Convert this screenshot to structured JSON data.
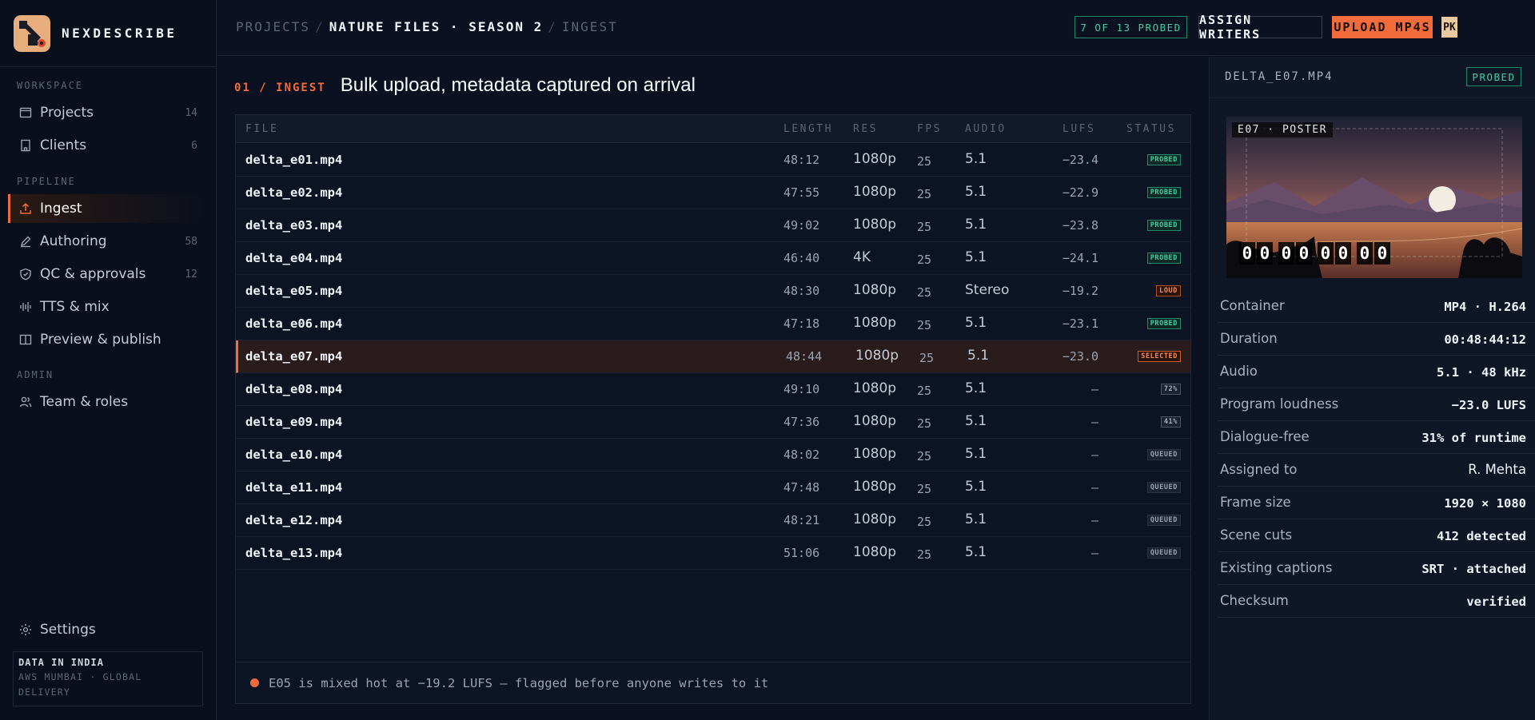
{
  "brand": {
    "name": "NEXDESCRIBE"
  },
  "sidebar": {
    "sections": {
      "workspace": "WORKSPACE",
      "pipeline": "PIPELINE",
      "admin": "ADMIN"
    },
    "items": [
      {
        "label": "Projects",
        "count": "14",
        "icon": "folder-icon"
      },
      {
        "label": "Clients",
        "count": "6",
        "icon": "building-icon"
      },
      {
        "label": "Ingest",
        "count": "",
        "icon": "upload-icon",
        "active": true
      },
      {
        "label": "Authoring",
        "count": "58",
        "icon": "pen-icon"
      },
      {
        "label": "QC & approvals",
        "count": "12",
        "icon": "shield-check-icon"
      },
      {
        "label": "TTS & mix",
        "count": "",
        "icon": "waveform-icon"
      },
      {
        "label": "Preview & publish",
        "count": "",
        "icon": "book-open-icon"
      },
      {
        "label": "Team & roles",
        "count": "",
        "icon": "users-icon"
      }
    ],
    "settings": "Settings",
    "region": {
      "title": "DATA IN INDIA",
      "subtitle": "AWS MUMBAI · GLOBAL DELIVERY"
    }
  },
  "header": {
    "breadcrumb": [
      "PROJECTS",
      "NATURE FILES · SEASON 2",
      "INGEST"
    ],
    "probed_status": "7 OF 13 PROBED",
    "assign_label": "ASSIGN WRITERS",
    "upload_label": "UPLOAD MP4S",
    "avatar_initials": "PK"
  },
  "main": {
    "step": "01 / INGEST",
    "title": "Bulk upload, metadata captured on arrival",
    "columns": [
      "FILE",
      "LENGTH",
      "RES",
      "FPS",
      "AUDIO",
      "LUFS",
      "STATUS"
    ],
    "rows": [
      {
        "file": "delta_e01.mp4",
        "length": "48:12",
        "res": "1080p",
        "fps": "25",
        "audio": "5.1",
        "lufs": "−23.4",
        "status": "PROBED",
        "kind": "probed"
      },
      {
        "file": "delta_e02.mp4",
        "length": "47:55",
        "res": "1080p",
        "fps": "25",
        "audio": "5.1",
        "lufs": "−22.9",
        "status": "PROBED",
        "kind": "probed"
      },
      {
        "file": "delta_e03.mp4",
        "length": "49:02",
        "res": "1080p",
        "fps": "25",
        "audio": "5.1",
        "lufs": "−23.8",
        "status": "PROBED",
        "kind": "probed"
      },
      {
        "file": "delta_e04.mp4",
        "length": "46:40",
        "res": "4K",
        "fps": "25",
        "audio": "5.1",
        "lufs": "−24.1",
        "status": "PROBED",
        "kind": "probed"
      },
      {
        "file": "delta_e05.mp4",
        "length": "48:30",
        "res": "1080p",
        "fps": "25",
        "audio": "Stereo",
        "lufs": "−19.2",
        "status": "LOUD",
        "kind": "loud"
      },
      {
        "file": "delta_e06.mp4",
        "length": "47:18",
        "res": "1080p",
        "fps": "25",
        "audio": "5.1",
        "lufs": "−23.1",
        "status": "PROBED",
        "kind": "probed"
      },
      {
        "file": "delta_e07.mp4",
        "length": "48:44",
        "res": "1080p",
        "fps": "25",
        "audio": "5.1",
        "lufs": "−23.0",
        "status": "SELECTED",
        "kind": "selected"
      },
      {
        "file": "delta_e08.mp4",
        "length": "49:10",
        "res": "1080p",
        "fps": "25",
        "audio": "5.1",
        "lufs": "—",
        "status": "72%",
        "kind": "pct"
      },
      {
        "file": "delta_e09.mp4",
        "length": "47:36",
        "res": "1080p",
        "fps": "25",
        "audio": "5.1",
        "lufs": "—",
        "status": "41%",
        "kind": "pct"
      },
      {
        "file": "delta_e10.mp4",
        "length": "48:02",
        "res": "1080p",
        "fps": "25",
        "audio": "5.1",
        "lufs": "—",
        "status": "QUEUED",
        "kind": "queued"
      },
      {
        "file": "delta_e11.mp4",
        "length": "47:48",
        "res": "1080p",
        "fps": "25",
        "audio": "5.1",
        "lufs": "—",
        "status": "QUEUED",
        "kind": "queued"
      },
      {
        "file": "delta_e12.mp4",
        "length": "48:21",
        "res": "1080p",
        "fps": "25",
        "audio": "5.1",
        "lufs": "—",
        "status": "QUEUED",
        "kind": "queued"
      },
      {
        "file": "delta_e13.mp4",
        "length": "51:06",
        "res": "1080p",
        "fps": "25",
        "audio": "5.1",
        "lufs": "—",
        "status": "QUEUED",
        "kind": "queued"
      }
    ],
    "footnote": "E05 is mixed hot at −19.2 LUFS — flagged before anyone writes to it"
  },
  "detail": {
    "file": "DELTA_E07.MP4",
    "status": "PROBED",
    "poster_label": "E07 · POSTER",
    "timecode": "00:00:00:00",
    "meta": [
      {
        "key": "Container",
        "value": "MP4 · H.264"
      },
      {
        "key": "Duration",
        "value": "00:48:44:12"
      },
      {
        "key": "Audio",
        "value": "5.1 · 48 kHz"
      },
      {
        "key": "Program loudness",
        "value": "−23.0 LUFS"
      },
      {
        "key": "Dialogue-free",
        "value": "31% of runtime"
      },
      {
        "key": "Assigned to",
        "value": "R. Mehta"
      },
      {
        "key": "Frame size",
        "value": "1920 × 1080"
      },
      {
        "key": "Scene cuts",
        "value": "412 detected"
      },
      {
        "key": "Existing captions",
        "value": "SRT · attached"
      },
      {
        "key": "Checksum",
        "value": "verified"
      }
    ]
  },
  "colors": {
    "accent": "#f26b3a",
    "success": "#3fd0a4",
    "background": "#0b1120"
  }
}
